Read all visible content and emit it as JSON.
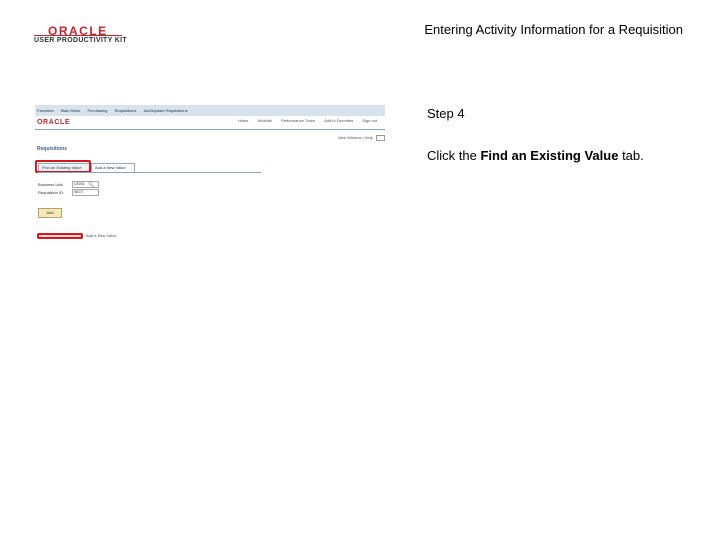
{
  "branding": {
    "oracle": "ORACLE",
    "subtitle": "USER PRODUCTIVITY KIT",
    "color": "#c4262e"
  },
  "document_title": "Entering Activity Information for a Requisition",
  "screenshot": {
    "nav": [
      "Favorites",
      "Main Menu",
      "Purchasing",
      "Requisitions",
      "Add/Update Requisitions"
    ],
    "brand": "ORACLE",
    "header_links": [
      "Home",
      "Worklist",
      "Performance Trace",
      "Add to Favorites",
      "Sign out"
    ],
    "tools": "New Window | Help",
    "page_title": "Requisitions",
    "tabs": {
      "find": "Find an Existing Value",
      "add": "Add a New Value"
    },
    "fields": [
      {
        "label": "Business Unit:",
        "value": "US001"
      },
      {
        "label": "Requisition ID:",
        "value": "NEXT"
      }
    ],
    "add_button": "Add",
    "bottom_link": "Add a New Value",
    "highlight_color": "#d9141b"
  },
  "step": "Step 4",
  "instruction": {
    "prefix": "Click the ",
    "target": "Find an Existing Value",
    "suffix": " tab."
  }
}
